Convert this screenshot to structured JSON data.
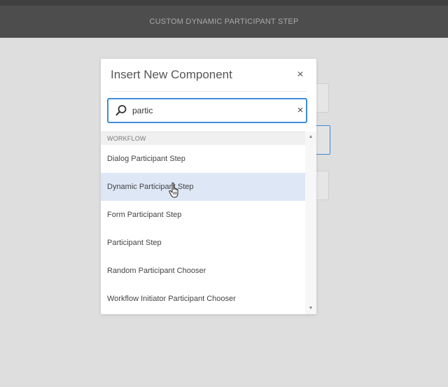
{
  "header": {
    "title": "CUSTOM DYNAMIC PARTICIPANT STEP"
  },
  "dialog": {
    "title": "Insert New Component",
    "close_icon": "close-icon",
    "close_glyph": "×",
    "search": {
      "value": "partic",
      "icon": "search-icon",
      "clear_icon": "clear-icon",
      "clear_glyph": "×"
    },
    "groups": [
      {
        "name": "WORKFLOW",
        "items": [
          {
            "label": "Dialog Participant Step",
            "hovered": false
          },
          {
            "label": "Dynamic Participant Step",
            "hovered": true
          },
          {
            "label": "Form Participant Step",
            "hovered": false
          },
          {
            "label": "Participant Step",
            "hovered": false
          },
          {
            "label": "Random Participant Chooser",
            "hovered": false
          },
          {
            "label": "Workflow Initiator Participant Chooser",
            "hovered": false
          }
        ]
      }
    ],
    "scroll_up_glyph": "▲",
    "scroll_down_glyph": "▼"
  },
  "colors": {
    "header_bg": "#4d4d4d",
    "canvas_bg": "#dedede",
    "accent": "#3e8ed9",
    "hover_row": "#dde7f5"
  }
}
